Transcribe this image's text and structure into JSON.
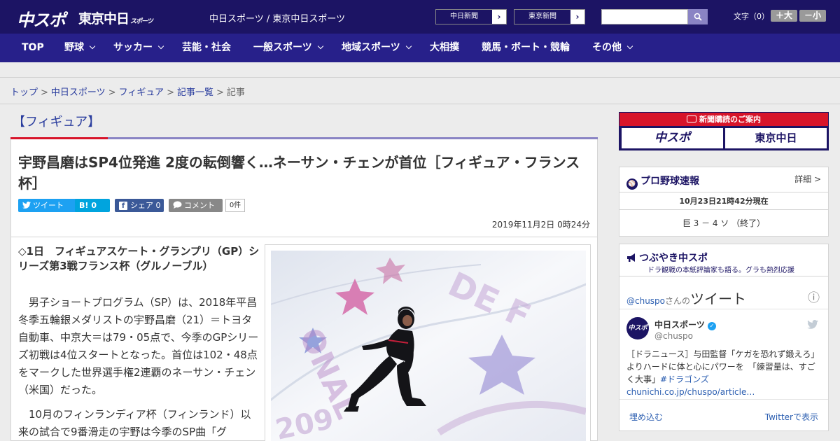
{
  "header": {
    "logo_chuspo": "中スポ",
    "logo_tokyo": "東京中日",
    "logo_tokyo_small": "スポーツ",
    "site_title": "中日スポーツ / 東京中日スポーツ",
    "ext_buttons": [
      {
        "label": "中日新聞",
        "arrow": "›"
      },
      {
        "label": "東京新聞",
        "arrow": "›"
      }
    ],
    "search": {
      "value": "",
      "placeholder": ""
    },
    "font_size_label": "文字（0）",
    "font_plus": "＋大",
    "font_minus": "－小"
  },
  "nav": {
    "items": [
      {
        "label": "TOP"
      },
      {
        "label": "野球"
      },
      {
        "label": "サッカー"
      },
      {
        "label": "芸能・社会"
      },
      {
        "label": "一般スポーツ"
      },
      {
        "label": "地域スポーツ"
      },
      {
        "label": "大相撲"
      },
      {
        "label": "競馬・ボート・競輪"
      },
      {
        "label": "その他"
      }
    ]
  },
  "breadcrumb": {
    "items": [
      "トップ",
      "中日スポーツ",
      "フィギュア",
      "記事一覧"
    ],
    "current": "記事",
    "sep": ">"
  },
  "article": {
    "category": "【フィギュア】",
    "headline": "宇野昌磨はSP4位発進 2度の転倒響く…ネーサン・チェンが首位［フィギュア・フランス杯］",
    "share": {
      "twitter": "ツイート",
      "hatena_icon": "B!",
      "hatena_count": "0",
      "facebook": "シェア",
      "facebook_count": "0",
      "comment": "コメント",
      "comment_count": "0件"
    },
    "date": "2019年11月2日 0時24分",
    "subhead": "◇1日　フィギュアスケート・グランプリ（GP）シリーズ第3戦フランス杯（グルノーブル）",
    "paragraph1": "　男子ショートプログラム（SP）は、2018年平昌冬季五輪銀メダリストの宇野昌磨（21）＝トヨタ自動車、中京大＝は79・05点で、今季のGPシリーズ初戦は4位スタートとなった。首位は102・48点をマークした世界選手権2連覇のネーサン・チェン（米国）だった。",
    "paragraph2": "　10月のフィンランディア杯（フィンランド）以来の試合で9番滑走の宇野は今季のSP曲「グ"
  },
  "sidebar": {
    "subscription": {
      "title": "新聞購読のご案内",
      "logo1": "中スポ",
      "logo2": "東京中日"
    },
    "baseball": {
      "title": "プロ野球速報",
      "detail": "詳細 >",
      "time": "10月23日21時42分現在",
      "score": "巨 3 － 4 ソ （終了）"
    },
    "tsubuyaki": {
      "title": "つぶやき中スポ",
      "subtitle": "ドラ観戦の本紙評論家も語る。グラも熱烈応援",
      "account_handle": "@chuspo",
      "account_suffix": "さんの",
      "tweet_heading": "ツイート",
      "info": "ⓘ",
      "user_name": "中日スポーツ",
      "user_handle": "@chuspo",
      "avatar_text": "中スポ",
      "tweet_text": "［ドラニュース］与田監督「ケガを恐れず鍛えろ」　よりハードに体と心にパワーを　「練習量は、すごく大事」",
      "tweet_hashtag": "#ドラゴンズ",
      "tweet_link": "chunichi.co.jp/chuspo/article…",
      "embed": "埋め込む",
      "view_on_twitter": "Twitterで表示"
    }
  },
  "colors": {
    "header_bg": "#1c1464",
    "nav_bg": "#27208a",
    "accent_red": "#d7142a",
    "accent_purple": "#8a84c4",
    "link": "#2a3d9e",
    "twitter": "#1da1f2",
    "hatena": "#00a4de",
    "facebook": "#3b5998",
    "comment": "#888888"
  }
}
